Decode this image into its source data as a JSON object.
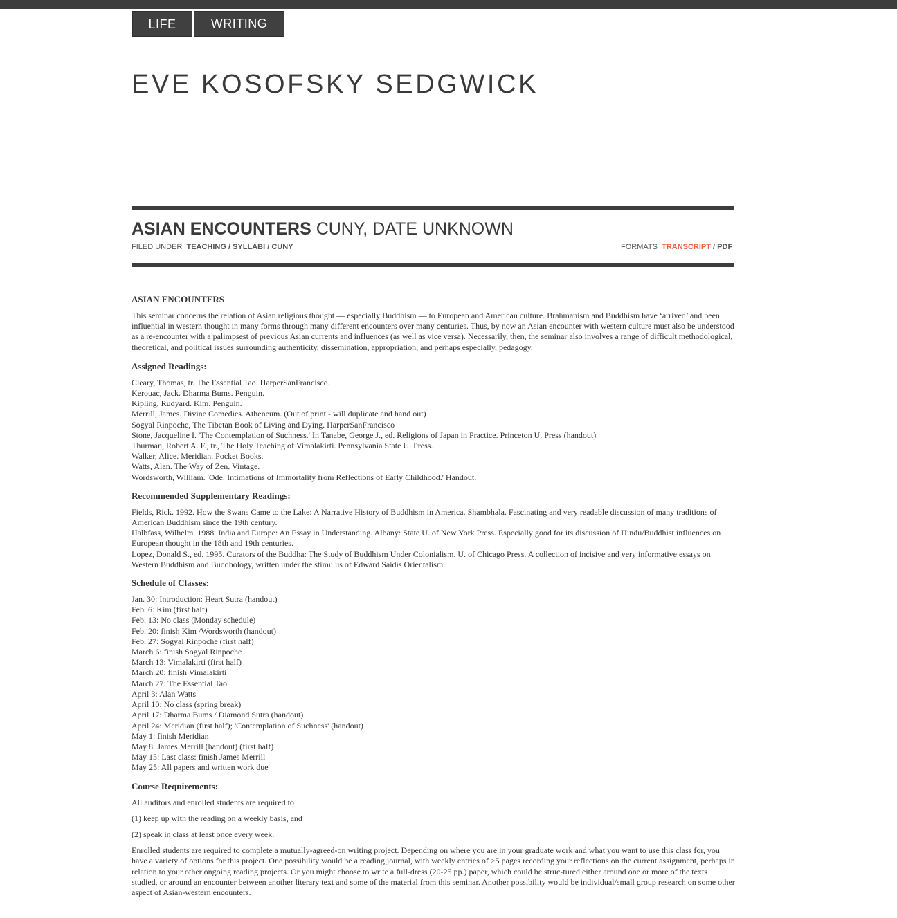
{
  "nav": {
    "tabs": [
      {
        "label": "LIFE"
      },
      {
        "label": "WRITING"
      }
    ]
  },
  "site": {
    "title": "EVE KOSOFSKY SEDGWICK"
  },
  "post": {
    "title_bold": "ASIAN ENCOUNTERS",
    "title_rest": " CUNY, DATE UNKNOWN",
    "filed_under_label": "FILED UNDER",
    "categories": [
      "TEACHING",
      "SYLLABI",
      "CUNY"
    ],
    "formats_label": "FORMATS",
    "formats": [
      "TRANSCRIPT",
      "PDF"
    ]
  },
  "content": {
    "heading": "ASIAN ENCOUNTERS",
    "intro": "This seminar concerns the relation of Asian religious thought — especially Buddhism — to European and American culture. Brahmanism and Buddhism have ‘arrived’ and been influential in western thought in many forms through many different encounters over many centuries. Thus, by now an Asian encounter with western culture must also be understood as a re-encounter with a palimpsest of previous Asian currents and influences (as well as vice versa). Necessarily, then, the seminar also involves a range of difficult methodological, theoretical, and political issues surrounding authenticity, dissemination, appropriation, and perhaps especially, pedagogy.",
    "assigned_heading": "Assigned Readings:",
    "assigned": [
      "Cleary, Thomas, tr.  The Essential Tao.  HarperSanFrancisco.",
      "Kerouac, Jack.  Dharma Bums.  Penguin.",
      "Kipling, Rudyard.  Kim.  Penguin.",
      "Merrill, James. Divine Comedies.  Atheneum.  (Out of print - will duplicate and hand out)",
      "Sogyal Rinpoche,  The Tibetan Book of Living and Dying.  HarperSanFrancisco",
      "Stone, Jacqueline I. 'The Contemplation of Suchness.'  In Tanabe, George J., ed.  Religions of Japan in Practice.  Princeton U. Press (handout)",
      "Thurman, Robert A. F., tr.,  The Holy Teaching of Vimalakirti.  Pennsylvania State U. Press.",
      "Walker, Alice.  Meridian. Pocket Books.",
      "Watts, Alan.  The Way of Zen.  Vintage.",
      "Wordsworth, William.  'Ode: Intimations of Immortality from Reflections of Early Childhood.'  Handout."
    ],
    "recommended_heading": "Recommended Supplementary Readings:",
    "recommended": [
      "Fields, Rick.  1992.  How the Swans Came to the Lake: A Narrative History of Buddhism in America.  Shambhala.  Fascinating and very readable discussion of many traditions of American Buddhism since the 19th century.",
      "Halbfass, Wilhelm. 1988. India and Europe: An Essay in Understanding.  Albany: State U. of New York Press.  Especially good for its discussion of Hindu/Buddhist influences on European thought in the 18th and 19th centuries.",
      "Lopez, Donald S., ed.  1995.  Curators of the Buddha: The Study of Buddhism Under Colonialism.  U. of Chicago Press.  A collection of incisive and very informative essays on Western Buddhism and Buddhology, written under the stimulus of Edward Saidís Orientalism."
    ],
    "schedule_heading": "Schedule of Classes:",
    "schedule": [
      "Jan. 30:  Introduction: Heart Sutra (handout)",
      "Feb. 6: Kim (first half)",
      "Feb. 13: No class (Monday schedule)",
      "Feb. 20: finish Kim /Wordsworth (handout)",
      "Feb. 27: Sogyal Rinpoche (first half)",
      "March 6: finish Sogyal Rinpoche",
      "March 13: Vimalakirti (first half)",
      "March 20: finish Vimalakirti",
      "March 27: The Essential Tao",
      "April 3: Alan Watts",
      "April 10: No class (spring break)",
      "April 17: Dharma Bums / Diamond Sutra (handout)",
      "April 24: Meridian (first half); 'Contemplation of Suchness' (handout)",
      "May 1: finish Meridian",
      "May 8: James Merrill (handout) (first half)",
      "May 15: Last class: finish James Merrill",
      "May 25: All papers and written work due"
    ],
    "requirements_heading": "Course Requirements:",
    "req_intro": "All auditors and enrolled students are required to",
    "req_1": "(1) keep up with the reading on a weekly basis, and",
    "req_2": "(2) speak in class at least once every week.",
    "req_enrolled": "Enrolled students are required to complete a mutually-agreed-on writing project.  Depending on where you are in your graduate work and what you want to use this class for, you have a variety of options for this project.  One possibility would be a reading journal, with weekly entries of  >5 pages recording your reflections on the current assignment, perhaps in relation to your other ongoing reading projects.  Or you might choose to write a full-dress (20-25 pp.) paper, which could be struc-tured either around one or more of the texts studied, or around an encounter between another literary text and some of the material from this seminar.  Another possibility would be individual/small group research on some other aspect of Asian-western encounters."
  }
}
